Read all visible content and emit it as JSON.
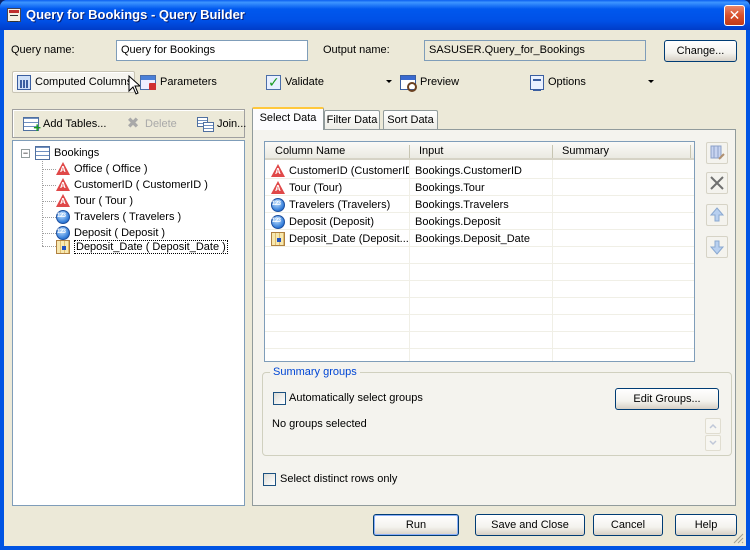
{
  "window": {
    "title": "Query for Bookings - Query Builder",
    "close_glyph": "✕"
  },
  "header": {
    "query_name_label": "Query name:",
    "query_name_value": "Query for Bookings",
    "output_name_label": "Output name:",
    "output_name_value": "SASUSER.Query_for_Bookings",
    "change_button": "Change..."
  },
  "toolbar": {
    "computed_columns": "Computed Columns",
    "parameters": "Parameters",
    "validate": "Validate",
    "preview": "Preview",
    "options": "Options"
  },
  "left_toolbar": {
    "add_tables": "Add Tables...",
    "delete": "Delete",
    "join": "Join..."
  },
  "tree": {
    "root": "Bookings",
    "items": [
      {
        "label": "Office ( Office )",
        "type": "character"
      },
      {
        "label": "CustomerID ( CustomerID )",
        "type": "character"
      },
      {
        "label": "Tour ( Tour )",
        "type": "character"
      },
      {
        "label": "Travelers ( Travelers )",
        "type": "numeric"
      },
      {
        "label": "Deposit ( Deposit )",
        "type": "numeric"
      },
      {
        "label": "Deposit_Date ( Deposit_Date )",
        "type": "date",
        "selected": true
      }
    ]
  },
  "tabs": [
    {
      "label": "Select Data",
      "active": true
    },
    {
      "label": "Filter Data",
      "active": false
    },
    {
      "label": "Sort Data",
      "active": false
    }
  ],
  "grid": {
    "columns": [
      "Column Name",
      "Input",
      "Summary"
    ],
    "rows": [
      {
        "name": "CustomerID (CustomerID)",
        "input": "Bookings.CustomerID",
        "summary": "",
        "type": "character"
      },
      {
        "name": "Tour (Tour)",
        "input": "Bookings.Tour",
        "summary": "",
        "type": "character"
      },
      {
        "name": "Travelers (Travelers)",
        "input": "Bookings.Travelers",
        "summary": "",
        "type": "numeric"
      },
      {
        "name": "Deposit (Deposit)",
        "input": "Bookings.Deposit",
        "summary": "",
        "type": "numeric"
      },
      {
        "name": "Deposit_Date (Deposit...",
        "input": "Bookings.Deposit_Date",
        "summary": "",
        "type": "date"
      }
    ]
  },
  "summary_groups": {
    "title": "Summary groups",
    "auto_select_label": "Automatically select groups",
    "auto_select_checked": false,
    "edit_groups_button": "Edit Groups...",
    "status": "No groups selected"
  },
  "distinct": {
    "label": "Select distinct rows only",
    "checked": false
  },
  "footer": {
    "run": "Run",
    "save_close": "Save and Close",
    "cancel": "Cancel",
    "help": "Help"
  }
}
